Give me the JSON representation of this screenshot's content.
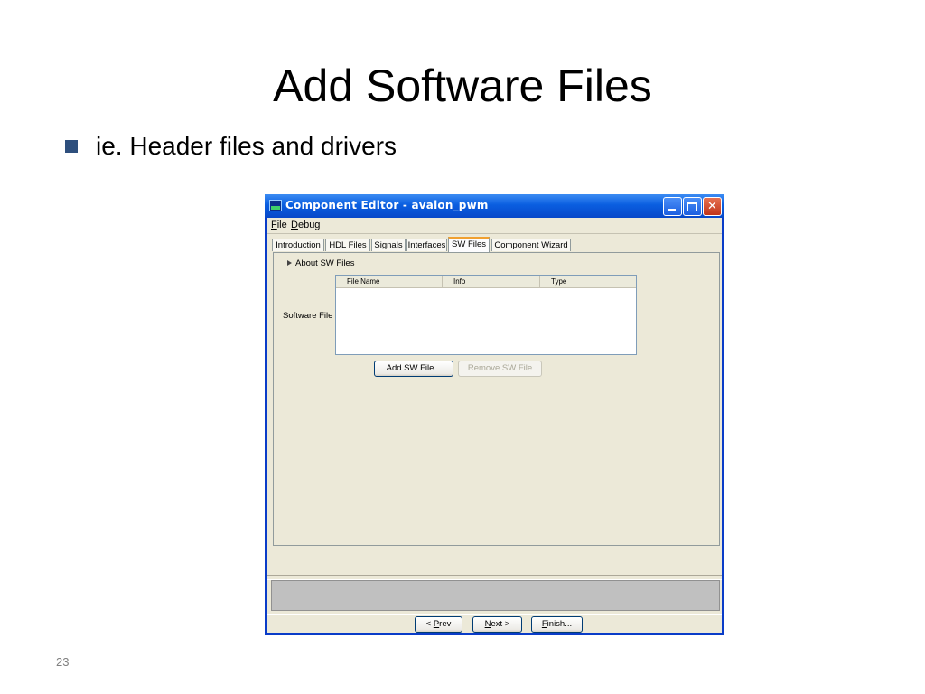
{
  "slide": {
    "title": "Add Software Files",
    "bullet": "ie.  Header files and drivers",
    "number": "23"
  },
  "window": {
    "title": "Component Editor - avalon_pwm",
    "icon": "app-icon",
    "controls": {
      "minimize": "minimize-icon",
      "maximize": "maximize-icon",
      "close": "close-icon"
    },
    "colors": {
      "titlebar": "#0a5ee0",
      "body": "#ece9d8",
      "close": "#c0341a"
    }
  },
  "menu": {
    "file_hotkey": "F",
    "file_rest": "ile",
    "debug_hotkey": "D",
    "debug_rest": "ebug"
  },
  "tabs": [
    "Introduction",
    "HDL Files",
    "Signals",
    "Interfaces",
    "SW Files",
    "Component Wizard"
  ],
  "active_tab": "SW Files",
  "panel": {
    "about": "About SW Files",
    "software_file_label": "Software File",
    "table_headers": [
      "File Name",
      "Info",
      "Type"
    ],
    "rows": [],
    "add_button": "Add SW File...",
    "remove_button": "Remove SW File"
  },
  "nav": {
    "prev_pre": "<  ",
    "prev_hotkey": "P",
    "prev_rest": "rev",
    "next_hotkey": "N",
    "next_rest": "ext  >",
    "finish_hotkey": "F",
    "finish_rest": "inish..."
  }
}
